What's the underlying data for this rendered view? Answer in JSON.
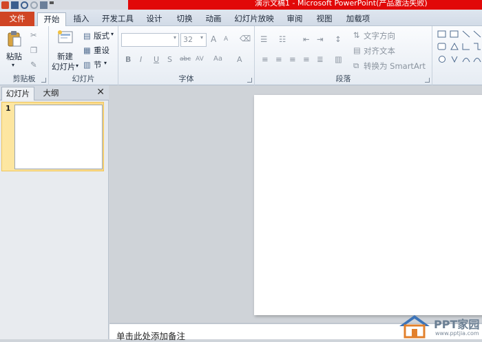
{
  "window": {
    "title": "演示文稿1 - Microsoft PowerPoint(产品激活失败)"
  },
  "ribbon_tabs": [
    {
      "label": "文件"
    },
    {
      "label": "开始"
    },
    {
      "label": "插入"
    },
    {
      "label": "开发工具"
    },
    {
      "label": "设计"
    },
    {
      "label": "切换"
    },
    {
      "label": "动画"
    },
    {
      "label": "幻灯片放映"
    },
    {
      "label": "审阅"
    },
    {
      "label": "视图"
    },
    {
      "label": "加载项"
    }
  ],
  "clipboard": {
    "paste_label": "粘贴",
    "group_label": "剪贴板"
  },
  "slides_group": {
    "new_slide_line1": "新建",
    "new_slide_line2": "幻灯片",
    "layout_label": "版式",
    "reset_label": "重设",
    "section_label": "节",
    "group_label": "幻灯片"
  },
  "font_group": {
    "font_name_value": "",
    "font_size_value": "32",
    "grow_label": "A",
    "shrink_label": "A",
    "bold_label": "B",
    "italic_label": "I",
    "underline_label": "U",
    "shadow_label": "S",
    "strike_label": "abc",
    "spacing_label": "AV",
    "case_label": "Aa",
    "color_label": "A",
    "group_label": "字体"
  },
  "paragraph_group": {
    "text_direction_label": "文字方向",
    "align_text_label": "对齐文本",
    "smartart_label": "转换为 SmartArt",
    "group_label": "段落"
  },
  "slide_panel": {
    "tab_slides": "幻灯片",
    "tab_outline": "大纲",
    "close_label": "✕",
    "slide_number": "1"
  },
  "notes": {
    "placeholder": "单击此处添加备注"
  },
  "watermark": {
    "text": "PPT家园",
    "url": "www.pptjia.com"
  },
  "colors": {
    "title_bar": "#e10808",
    "file_tab": "#d04524",
    "selected_thumbnail": "#fbd98a"
  }
}
